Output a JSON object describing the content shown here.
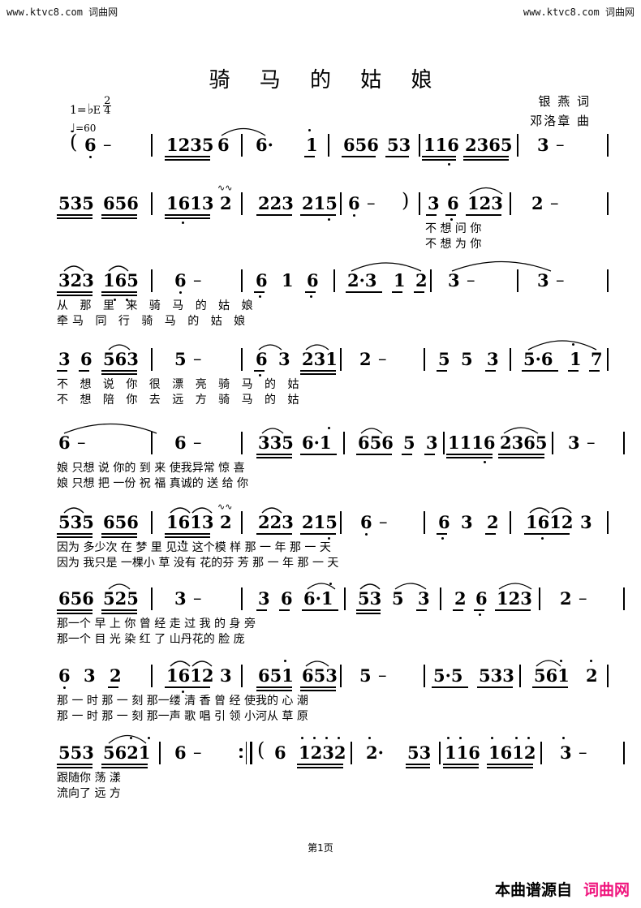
{
  "watermark": {
    "left": "www.ktvc8.com 词曲网",
    "right": "www.ktvc8.com 词曲网"
  },
  "title": "骑 马 的 姑 娘",
  "credits": {
    "lyricist": "银  燕 词",
    "composer": "邓洛章 曲"
  },
  "key": {
    "prefix": "1=",
    "accidental": "♭",
    "letter": "E",
    "meter_num": "2",
    "meter_den": "4",
    "tempo_label": "=60",
    "tempo_note": "♩"
  },
  "score": {
    "lines": [
      {
        "id": "line1",
        "measures": [
          "( 6̣  –",
          "1235  6",
          "6·    1̇",
          "656  53",
          "116  2365",
          "3  –"
        ]
      },
      {
        "id": "line2",
        "measures": [
          "535  656",
          "1613  2",
          "223  215",
          "6̣  –   )",
          "3  6̣  123",
          "2  –"
        ],
        "lyrics_1": "不 想 问    你",
        "lyrics_2": "不 想 为    你"
      },
      {
        "id": "line3",
        "measures": [
          "323  165",
          "6̣  –",
          "6̣  1  6̣",
          "2·3  1  2",
          "3  –",
          "3  –"
        ],
        "lyrics_1": "从  那 里    来      骑 马 的  姑        娘",
        "lyrics_2": "牵马 同    行      骑 马 的  姑        娘"
      },
      {
        "id": "line4",
        "measures": [
          "3  6  563",
          "5  –",
          "6̣  3  231",
          "2  –",
          "5  5   3",
          "5·6  1̇  7"
        ],
        "lyrics_1": "不 想 说    你      很   漂    亮      骑 马 的  姑",
        "lyrics_2": "不 想 陪    你      去   远    方      骑 马 的  姑"
      },
      {
        "id": "line5",
        "measures": [
          "6  –",
          "6  –",
          "335  6·1̇",
          "656  5  3",
          "1116  2365",
          "3  –"
        ],
        "lyrics_1": "娘          只想 说    你的 到 来 使我异常 惊    喜",
        "lyrics_2": "娘          只想 把    一份 祝 福 真诚的 送 给  你"
      },
      {
        "id": "line6",
        "measures": [
          "535  656",
          "1613  2",
          "223  215",
          "6̣  –",
          "6̣  3  2",
          "1612  3"
        ],
        "lyrics_1": "因为 多少次 在 梦 里 见过 这个模 样      那 一 年 那 一 天",
        "lyrics_2": "因为 我只是 一棵小 草 没有 花的芬 芳      那 一 年 那 一 天"
      },
      {
        "id": "line7",
        "measures": [
          "656  525",
          "3  –",
          "3  6  6·1̇",
          "53  5  3",
          "2  6̣  123",
          "2  –"
        ],
        "lyrics_1": "那一个 早    上      你 曾 经  走  过   我 的 身  旁",
        "lyrics_2": "那一个 目    光      染  红 了  山丹花的 脸      庞"
      },
      {
        "id": "line8",
        "measures": [
          "6̣  3  2",
          "1612  3",
          "651̇  653",
          "5  –",
          "5·5  533",
          "561̇  2̇"
        ],
        "lyrics_1": "那 一 时  那 一 刻 那一缕 清    香      曾 经 使我的 心    潮",
        "lyrics_2": "那 一 时  那 一 刻 那一声 歌    唱      引 领 小河从 草    原"
      },
      {
        "id": "line9",
        "measures": [
          "553  5621̇",
          "6  –",
          ":‖ ( 6  1̇2̇3̇2̇",
          "2̇·    53",
          "1̇1̇6  1̇61̇2̇",
          "3̇  –"
        ],
        "lyrics_1": "跟随你 荡    漾",
        "lyrics_2": "流向了 远    方"
      }
    ]
  },
  "footer": {
    "page_label": "第1页",
    "source_prefix": "本曲谱源自",
    "source_brand": "词曲网",
    "brand_color": "#f0167e"
  }
}
